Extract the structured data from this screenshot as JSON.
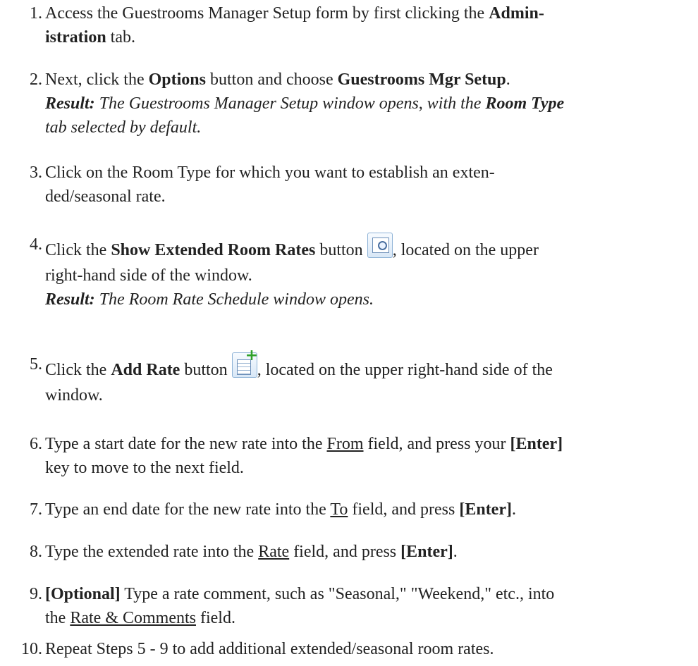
{
  "steps": [
    {
      "number": "1.",
      "lines": {
        "a1": "Access the Guestrooms Manager Setup form by first clicking the ",
        "a2": "Admin-",
        "b1": "istration",
        "b2": " tab."
      }
    },
    {
      "number": "2.",
      "lines": {
        "a1": "Next, click the ",
        "a2": "Options",
        "a3": " button and choose ",
        "a4": "Guestrooms Mgr Setup",
        "a5": ".",
        "b1": "Result:",
        "b2": " The Guestrooms Manager Setup window opens, with the ",
        "b3": "Room Type",
        "c1": "tab selected by default."
      }
    },
    {
      "number": "3.",
      "lines": {
        "a1": "Click on the Room Type for which you want to establish an exten-",
        "b1": "ded/seasonal rate."
      }
    },
    {
      "number": "4.",
      "lines": {
        "a1": "Click the ",
        "a2": "Show Extended Room Rates",
        "a3": " button ",
        "a4": ", located on the upper",
        "b1": "right-hand side of the window.",
        "c1": "Result:",
        "c2": " The Room Rate Schedule window opens."
      }
    },
    {
      "number": "5.",
      "lines": {
        "a1": "Click the ",
        "a2": "Add Rate",
        "a3": " button ",
        "a4": ", located on the upper right-hand side of the",
        "b1": "window."
      }
    },
    {
      "number": "6.",
      "lines": {
        "a1": "Type a start date for the new rate into the ",
        "a2": "From",
        "a3": " field, and press your ",
        "a4": "[Enter]",
        "b1": "key to move to the next field."
      }
    },
    {
      "number": "7.",
      "lines": {
        "a1": "Type an end date for the new rate into the ",
        "a2": "To",
        "a3": " field, and press ",
        "a4": "[Enter]",
        "a5": "."
      }
    },
    {
      "number": "8.",
      "lines": {
        "a1": "Type the extended rate into the ",
        "a2": "Rate",
        "a3": " field, and press ",
        "a4": "[Enter]",
        "a5": "."
      }
    },
    {
      "number": "9.",
      "lines": {
        "a1": "[Optional]",
        "a2": " Type a rate comment, such as \"Seasonal,\" \"Weekend,\" etc., into",
        "b1": "the ",
        "b2": "Rate & Comments",
        "b3": " field."
      }
    },
    {
      "number": "10.",
      "lines": {
        "a1": "Repeat Steps 5 - 9 to add additional extended/seasonal room rates."
      }
    }
  ],
  "icons": {
    "show_extended_rates": "show-extended-room-rates-icon",
    "add_rate": "add-rate-icon"
  }
}
